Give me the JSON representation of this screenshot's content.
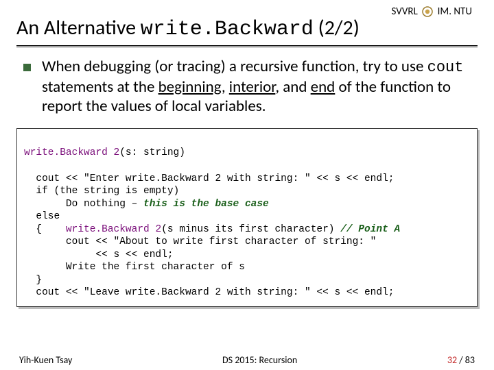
{
  "header": {
    "org_left": "SVVRL",
    "at": "@",
    "org_right": "IM. NTU"
  },
  "title": {
    "pre": "An Alternative ",
    "mono": "write.Backward",
    "post": " (2/2)"
  },
  "bullet": {
    "t1": "When debugging (or tracing) a recursive function, try to use ",
    "mono": "cout",
    "t2": " statements at the ",
    "u1": "beginning",
    "c1": ", ",
    "u2": "interior",
    "c2": ", and ",
    "u3": "end",
    "t3": " of the function to report the values of local variables."
  },
  "code": {
    "l1a": "write.Backward 2",
    "l1b": "(s: string)",
    "blank1": "",
    "l2": "  cout << \"Enter write.Backward 2 with string: \" << s << endl;",
    "l3": "  if (the string is empty)",
    "l4a": "       Do nothing – ",
    "l4b": "this is the base case",
    "l5": "  else",
    "l6a": "  {    ",
    "l6b": "write.Backward 2",
    "l6c": "(s minus its first character) ",
    "l6d": "// Point A",
    "l7": "       cout << \"About to write first character of string: \"",
    "l8": "            << s << endl;",
    "l9a": "       Write the first character of ",
    "l9b": "s",
    "l10": "  }",
    "l11": "  cout << \"Leave write.Backward 2 with string: \" << s << endl;"
  },
  "footer": {
    "author": "Yih-Kuen Tsay",
    "center": "DS 2015: Recursion",
    "page_cur": "32",
    "page_sep": " / ",
    "page_total": "83"
  }
}
